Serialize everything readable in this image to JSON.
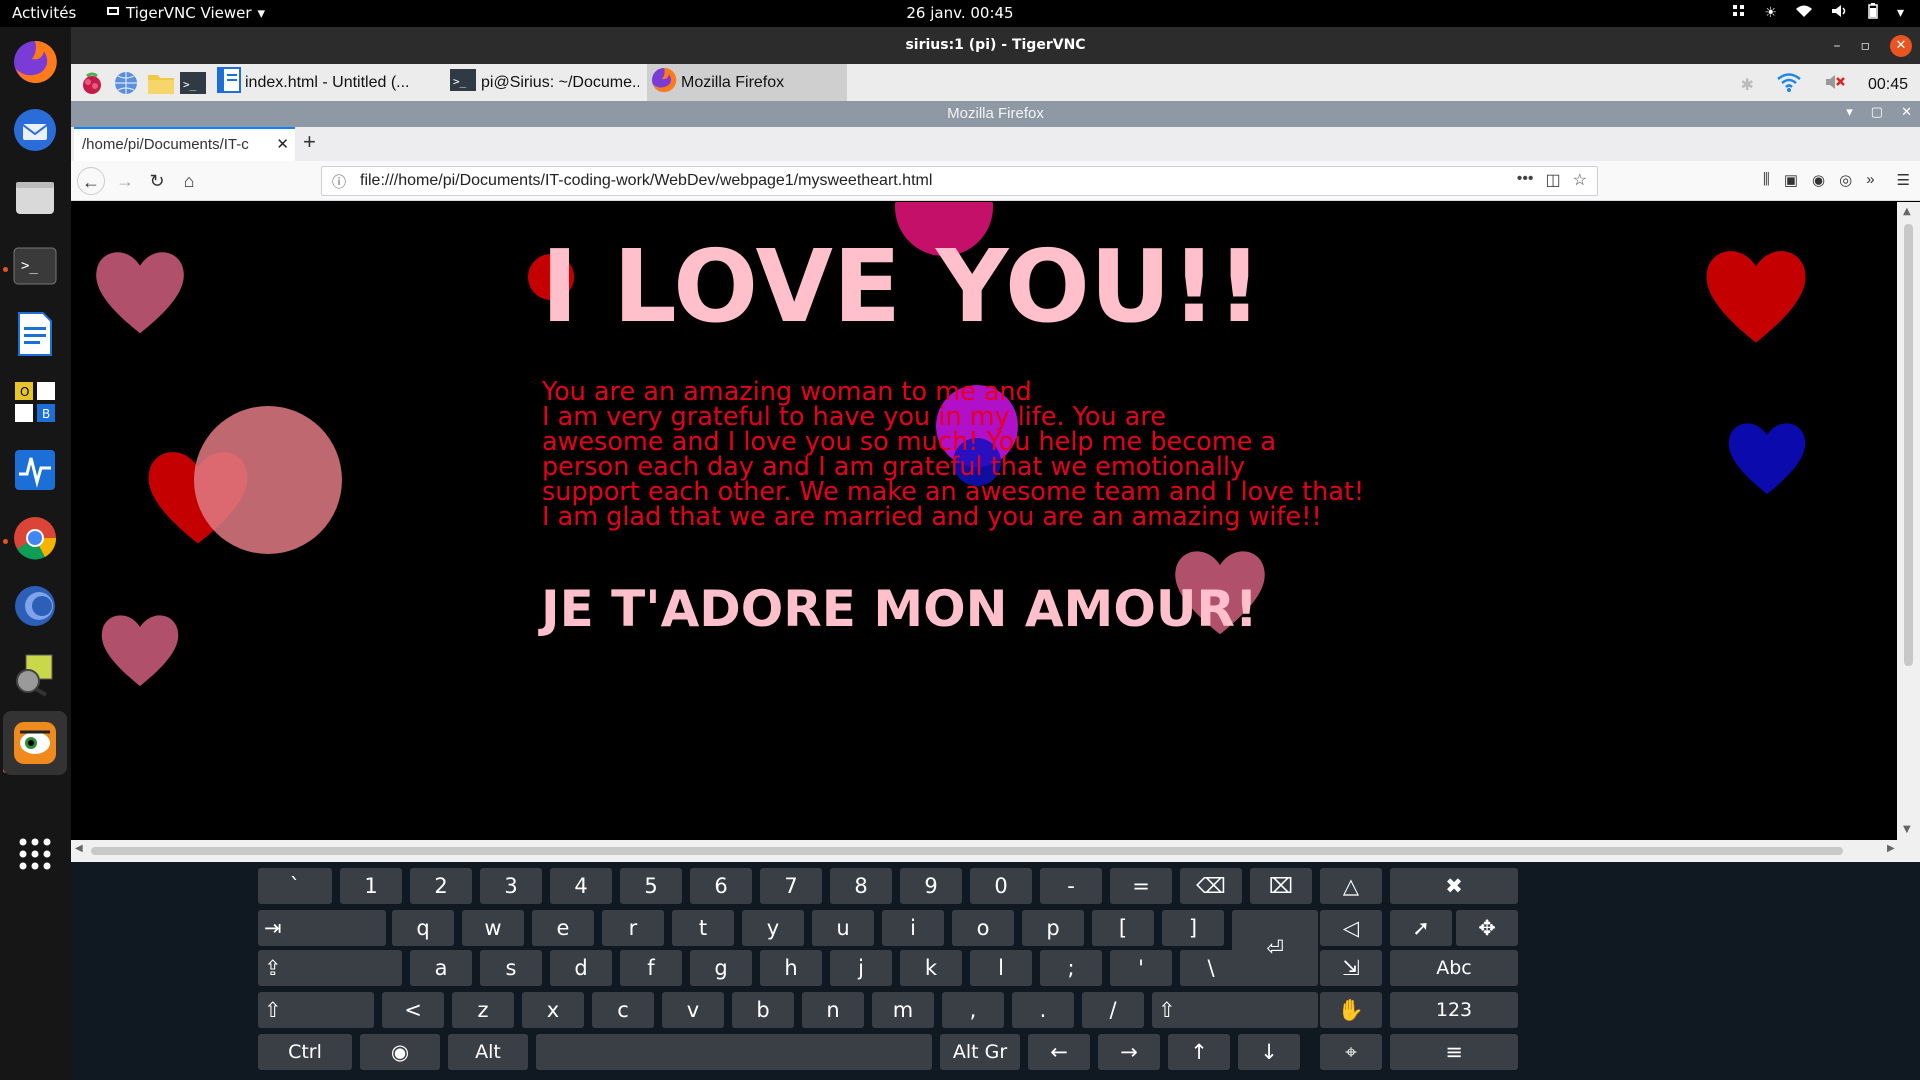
{
  "gnome": {
    "activities": "Activités",
    "app_name": "TigerVNC Viewer",
    "app_arrow": "▾",
    "clock": "26 janv.  00:45"
  },
  "vnc": {
    "title": "sirius:1 (pi) - TigerVNC",
    "min": "–",
    "max": "▫",
    "close": "✕"
  },
  "pi_taskbar": {
    "tasks": [
      {
        "label": "index.html - Untitled (..."
      },
      {
        "label": "pi@Sirius: ~/Docume..."
      },
      {
        "label": "Mozilla Firefox"
      }
    ],
    "clock": "00:45"
  },
  "firefox": {
    "window_title": "Mozilla Firefox",
    "tab_title": "/home/pi/Documents/IT-c",
    "tab_close": "✕",
    "new_tab": "+",
    "url": "file:///home/pi/Documents/IT-coding-work/WebDev/webpage1/mysweetheart.html",
    "page_actions_more": "•••"
  },
  "page": {
    "title": "I LOVE YOU!!",
    "paragraph": [
      "You are an amazing woman to me and",
      "I am very grateful to have you in my life. You are",
      "awesome and I love you so much! You help me become a",
      "person each day and I am grateful that we emotionally",
      "support each other. We make an awesome team and I love that!",
      "I am glad that we are married and you are an amazing wife!!"
    ],
    "french": "JE T'ADORE MON AMOUR!"
  },
  "colors": {
    "title_pink": "#ffc0cb",
    "paragraph_red": "#e8001b",
    "heart_rose": "#b0506a",
    "heart_red": "#c40000",
    "heart_blue": "#0a0aad",
    "ubuntu_orange": "#e95420"
  },
  "keyboard": {
    "row1": [
      "`",
      "1",
      "2",
      "3",
      "4",
      "5",
      "6",
      "7",
      "8",
      "9",
      "0",
      "-",
      "="
    ],
    "row2": [
      "q",
      "w",
      "e",
      "r",
      "t",
      "y",
      "u",
      "i",
      "o",
      "p",
      "[",
      "]"
    ],
    "row3": [
      "a",
      "s",
      "d",
      "f",
      "g",
      "h",
      "j",
      "k",
      "l",
      ";",
      "'",
      "\\"
    ],
    "row4": [
      "<",
      "z",
      "x",
      "c",
      "v",
      "b",
      "n",
      "m",
      ",",
      ".",
      "/"
    ],
    "ctrl": "Ctrl",
    "alt": "Alt",
    "altgr": "Alt Gr",
    "abc": "Abc",
    "num": "123",
    "arrows": [
      "←",
      "→",
      "↑",
      "↓"
    ],
    "tab": "⇥",
    "caps": "⇪",
    "shift": "⇧",
    "enter": "⏎",
    "backspace": "⌫",
    "del": "⌧",
    "close": "✖",
    "menu": "≡"
  }
}
